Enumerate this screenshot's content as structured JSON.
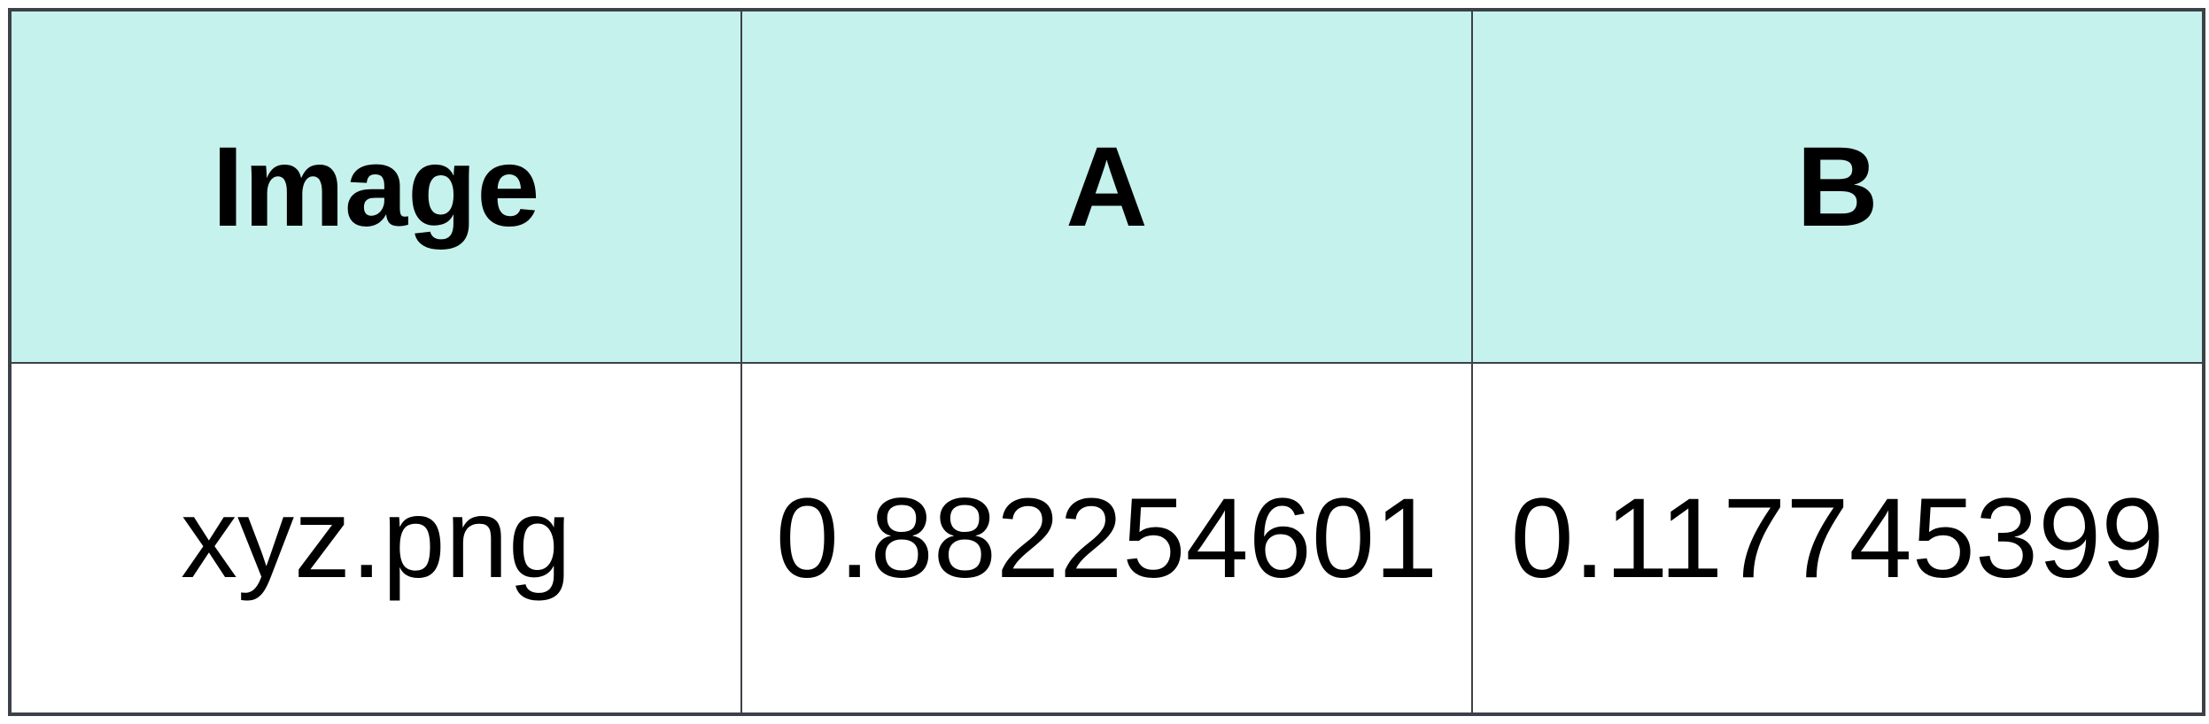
{
  "table": {
    "headers": [
      "Image",
      "A",
      "B"
    ],
    "rows": [
      [
        "xyz.png",
        "0.882254601",
        "0.117745399"
      ]
    ]
  },
  "colors": {
    "header_bg": "#c5f2ec",
    "border": "#3c4048"
  }
}
